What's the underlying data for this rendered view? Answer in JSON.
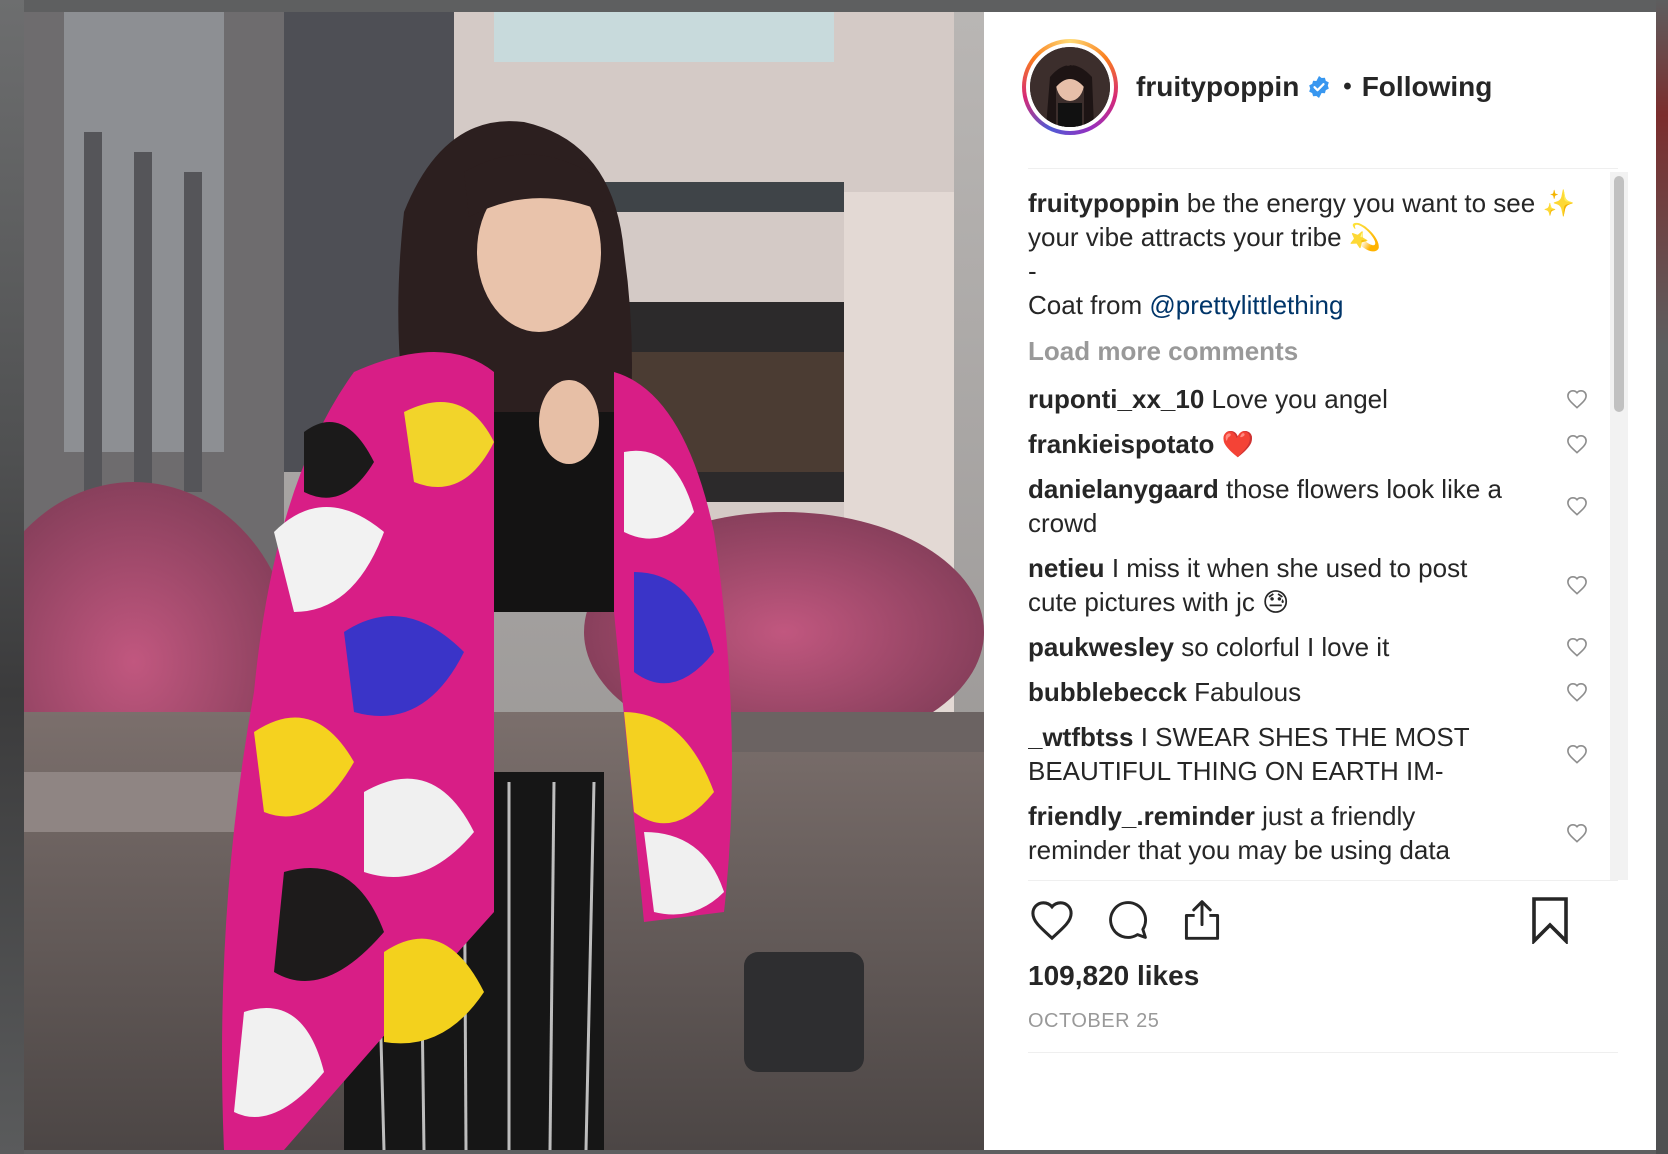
{
  "post": {
    "username": "fruitypoppin",
    "separator": "•",
    "follow_status": "Following",
    "caption_line1": "be the energy you want to see ✨   your vibe attracts your tribe 💫",
    "caption_dash": "-",
    "caption_coat_prefix": "Coat from ",
    "caption_mention": "@prettylittlething",
    "load_more": "Load more comments",
    "likes": "109,820 likes",
    "date": "OCTOBER 25"
  },
  "comments": [
    {
      "user": "ruponti_xx_10",
      "text": "Love you angel"
    },
    {
      "user": "frankieispotato",
      "text": "❤️"
    },
    {
      "user": "danielanygaard",
      "text": "those flowers look like a crowd"
    },
    {
      "user": "netieu",
      "text": "I miss it when she used to post cute pictures with jc 😓"
    },
    {
      "user": "paukwesley",
      "text": "so colorful I love it"
    },
    {
      "user": "bubblebecck",
      "text": "Fabulous"
    },
    {
      "user": "_wtfbtss",
      "text": "I SWEAR SHES THE MOST BEAUTIFUL THING ON EARTH IM-"
    },
    {
      "user": "friendly_.reminder",
      "text": "just a friendly reminder that you may be using data"
    }
  ],
  "icons": {
    "verified": "verified-badge-icon",
    "like": "heart-icon",
    "comment": "comment-bubble-icon",
    "share": "share-icon",
    "save": "bookmark-icon",
    "comment_like": "small-heart-icon"
  },
  "colors": {
    "text": "#262626",
    "muted": "#999999",
    "mention": "#003569",
    "verified": "#3897f0"
  }
}
